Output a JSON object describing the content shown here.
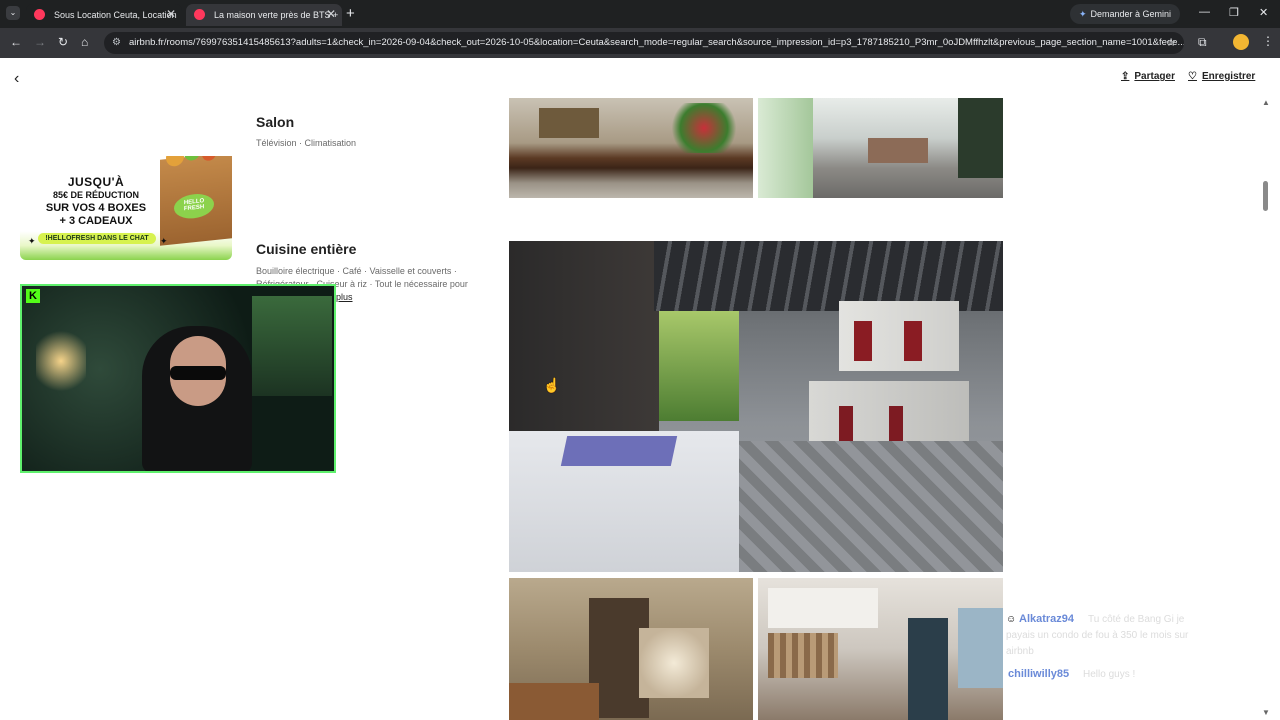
{
  "browser": {
    "tabs": [
      {
        "title": "Sous Location Ceuta, Location"
      },
      {
        "title": "La maison verte près de BTS +"
      }
    ],
    "new_tab": "+",
    "gemini_label": "Demander à Gemini",
    "url": "airbnb.fr/rooms/769976351415485613?adults=1&check_in=2026-09-04&check_out=2026-10-05&location=Ceuta&search_mode=regular_search&source_impression_id=p3_1787185210_P3mr_0oJDMffhzlt&previous_page_section_name=1001&fede..."
  },
  "page": {
    "share_label": "Partager",
    "save_label": "Enregistrer",
    "rooms": [
      {
        "title": "Salon",
        "amenities": "Télévision · Climatisation"
      },
      {
        "title": "Cuisine entière",
        "amenities": "Bouilloire électrique · Café · Vaisselle et couverts · Réfrigérateur · Cuiseur à riz · Tout le nécessaire pour",
        "more_label": "plus"
      }
    ]
  },
  "overlay": {
    "promo": {
      "line1": "JUSQU'À",
      "line2": "85€ DE RÉDUCTION",
      "line3": "SUR VOS 4 BOXES",
      "line4": "+ 3 CADEAUX",
      "pill": "!HELLOFRESH DANS LE CHAT",
      "brand": "HELLO FRESH"
    },
    "kick_logo": "K",
    "chat": [
      {
        "user": "Alkatraz94",
        "message": "Tu côté de Bang Gi je payais un condo de fou à 350 le mois sur airbnb",
        "color": "#6a8ad8"
      },
      {
        "user": "chilliwilly85",
        "message": "Hello guys !",
        "color": "#6a8ad8"
      }
    ]
  }
}
